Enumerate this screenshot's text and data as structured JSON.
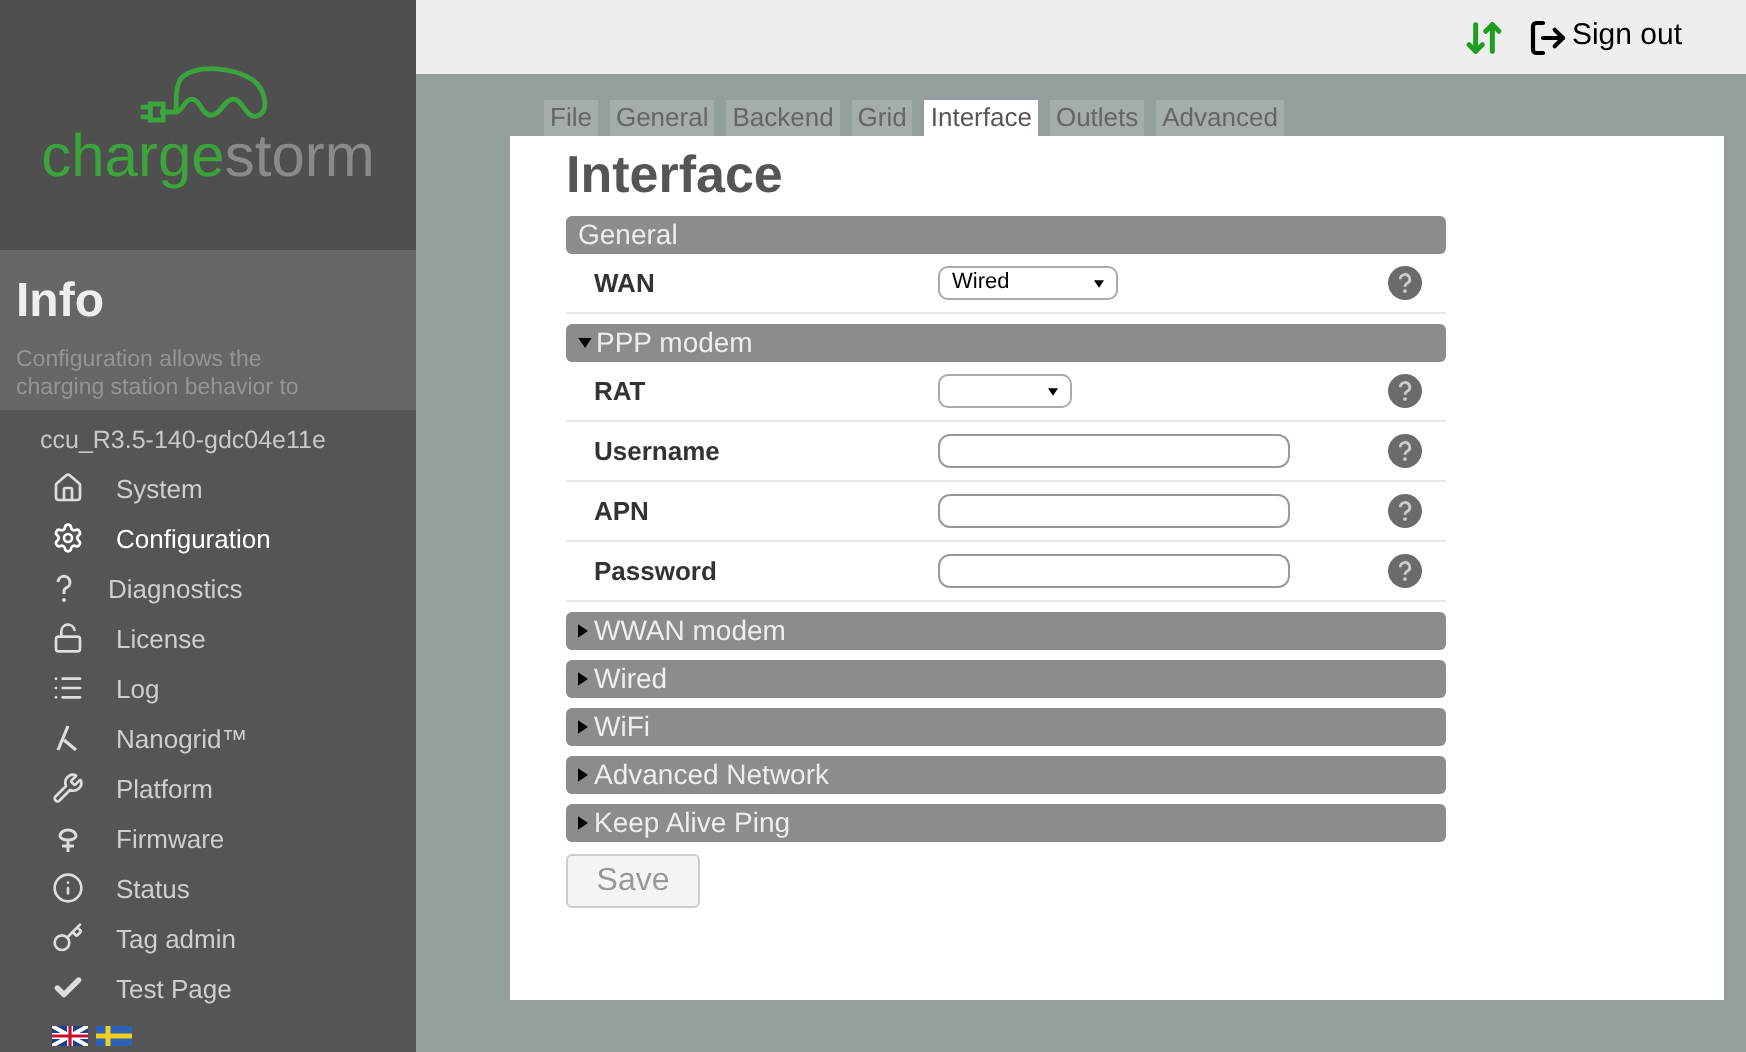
{
  "logo": {
    "text_parts": [
      "charge",
      "storm"
    ]
  },
  "info": {
    "title": "Info",
    "description": "Configuration allows the charging station behavior to",
    "version": "ccu_R3.5-140-gdc04e11e"
  },
  "sidebar": {
    "items": [
      {
        "label": "System",
        "selected": false
      },
      {
        "label": "Configuration",
        "selected": true
      },
      {
        "label": "Diagnostics",
        "selected": false
      },
      {
        "label": "License",
        "selected": false
      },
      {
        "label": "Log",
        "selected": false
      },
      {
        "label": "Nanogrid™",
        "selected": false
      },
      {
        "label": "Platform",
        "selected": false
      },
      {
        "label": "Firmware",
        "selected": false
      },
      {
        "label": "Status",
        "selected": false
      },
      {
        "label": "Tag admin",
        "selected": false
      },
      {
        "label": "Test Page",
        "selected": false
      }
    ]
  },
  "top_bar": {
    "sign_out": "Sign out"
  },
  "tabs": [
    {
      "label": "File",
      "selected": false
    },
    {
      "label": "General",
      "selected": false
    },
    {
      "label": "Backend",
      "selected": false
    },
    {
      "label": "Grid",
      "selected": false
    },
    {
      "label": "Interface",
      "selected": true
    },
    {
      "label": "Outlets",
      "selected": false
    },
    {
      "label": "Advanced",
      "selected": false
    }
  ],
  "page_title": "Interface",
  "sections": [
    {
      "title": "General",
      "fields": [
        {
          "label": "WAN",
          "kind": "select",
          "value": "Wired"
        }
      ]
    },
    {
      "title": "PPP modem",
      "collapsible": true,
      "expanded": true,
      "fields": [
        {
          "label": "RAT",
          "kind": "select"
        },
        {
          "label": "Username",
          "kind": "text"
        },
        {
          "label": "APN",
          "kind": "text"
        },
        {
          "label": "Password",
          "kind": "text"
        }
      ]
    },
    {
      "title": "WWAN modem",
      "collapsible": true,
      "expanded": false
    },
    {
      "title": "Wired",
      "collapsible": true,
      "expanded": false
    },
    {
      "title": "WiFi",
      "collapsible": true,
      "expanded": false
    },
    {
      "title": "Advanced Network",
      "collapsible": true,
      "expanded": false
    },
    {
      "title": "Keep Alive Ping",
      "collapsible": true,
      "expanded": false
    }
  ],
  "save_button": {
    "label": "Save",
    "disabled": true
  }
}
